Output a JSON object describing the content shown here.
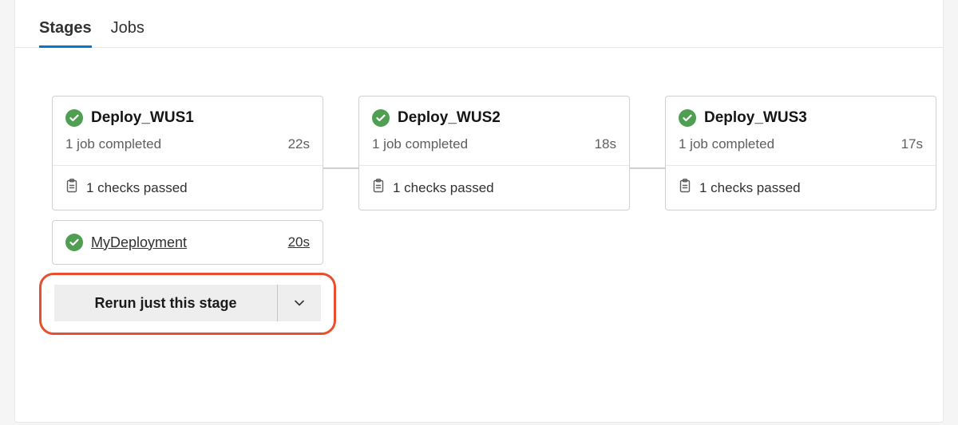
{
  "tabs": [
    {
      "label": "Stages",
      "active": true
    },
    {
      "label": "Jobs",
      "active": false
    }
  ],
  "stages": [
    {
      "title": "Deploy_WUS1",
      "status": "1 job completed",
      "duration": "22s",
      "checks": "1 checks passed",
      "expanded": {
        "job_name": "MyDeployment",
        "job_duration": "20s",
        "rerun_label": "Rerun just this stage"
      }
    },
    {
      "title": "Deploy_WUS2",
      "status": "1 job completed",
      "duration": "18s",
      "checks": "1 checks passed"
    },
    {
      "title": "Deploy_WUS3",
      "status": "1 job completed",
      "duration": "17s",
      "checks": "1 checks passed"
    }
  ]
}
